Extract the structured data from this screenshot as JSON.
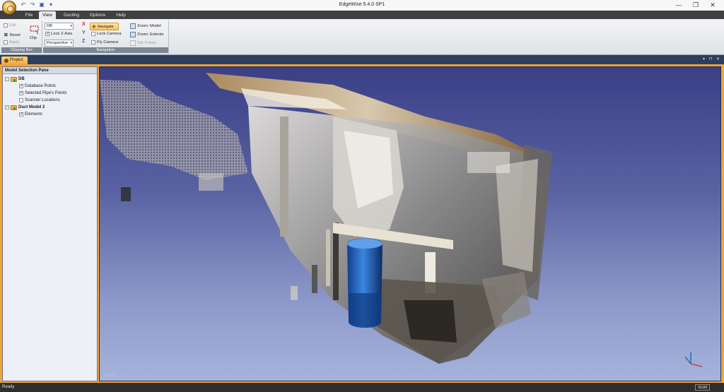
{
  "window": {
    "title": "EdgeWise 5.4.0 SP1",
    "controls": {
      "minimize": "—",
      "maximize": "❐",
      "close": "✕"
    }
  },
  "quick_access": [
    {
      "icon": "undo-icon",
      "glyph": "↶"
    },
    {
      "icon": "redo-icon",
      "glyph": "↷"
    },
    {
      "icon": "save-icon",
      "glyph": "▣"
    },
    {
      "icon": "customize-dropdown-icon",
      "glyph": "▾"
    }
  ],
  "menu": {
    "tabs": [
      {
        "label": "File",
        "active": false
      },
      {
        "label": "View",
        "active": true
      },
      {
        "label": "Ducting",
        "active": false
      },
      {
        "label": "Options",
        "active": false
      },
      {
        "label": "Help",
        "active": false
      }
    ]
  },
  "ribbon": {
    "clipping_box": {
      "label": "Clipping Box",
      "edit": "Edit",
      "reset": "Reset",
      "apply": "Apply",
      "clip": "Clip"
    },
    "navigation": {
      "label": "Navigation",
      "db_combo": "DB",
      "lock_z_axis": "Lock Z-Axis",
      "lock_z_axis_checked": true,
      "projection_combo": "Perspective",
      "axis_x": "X",
      "axis_y": "Y",
      "axis_z": "Z",
      "navigate": "Navigate",
      "lock_camera": "Lock Camera",
      "fly_camera": "Fly Camera",
      "zoom_model": "Zoom: Model",
      "zoom_extents": "Zoom: Extents",
      "set_x_axis": "Set X Axis"
    }
  },
  "doc_tab": {
    "label": "Project",
    "controls": "▾ ⊓ ✕"
  },
  "model_pane": {
    "title": "Model Selection Pane",
    "tree": [
      {
        "label": "DB",
        "level": 0,
        "kind": "group"
      },
      {
        "label": "Database Points",
        "level": 1,
        "checked": true
      },
      {
        "label": "Selected Pipe's Points",
        "level": 1,
        "checked": true
      },
      {
        "label": "Scanner Locations",
        "level": 1,
        "checked": false
      },
      {
        "label": "Duct Model 2",
        "level": 0,
        "kind": "group"
      },
      {
        "label": "Elements",
        "level": 1,
        "checked": true
      }
    ]
  },
  "viewport": {
    "watermark": "60 fps"
  },
  "status": {
    "left": "Ready",
    "num": "NUM"
  },
  "colors": {
    "accent": "#f0a33c",
    "viewport_top": "#3a3f86",
    "viewport_bottom": "#a6b3dc",
    "barrel": "#1f6fcf"
  }
}
